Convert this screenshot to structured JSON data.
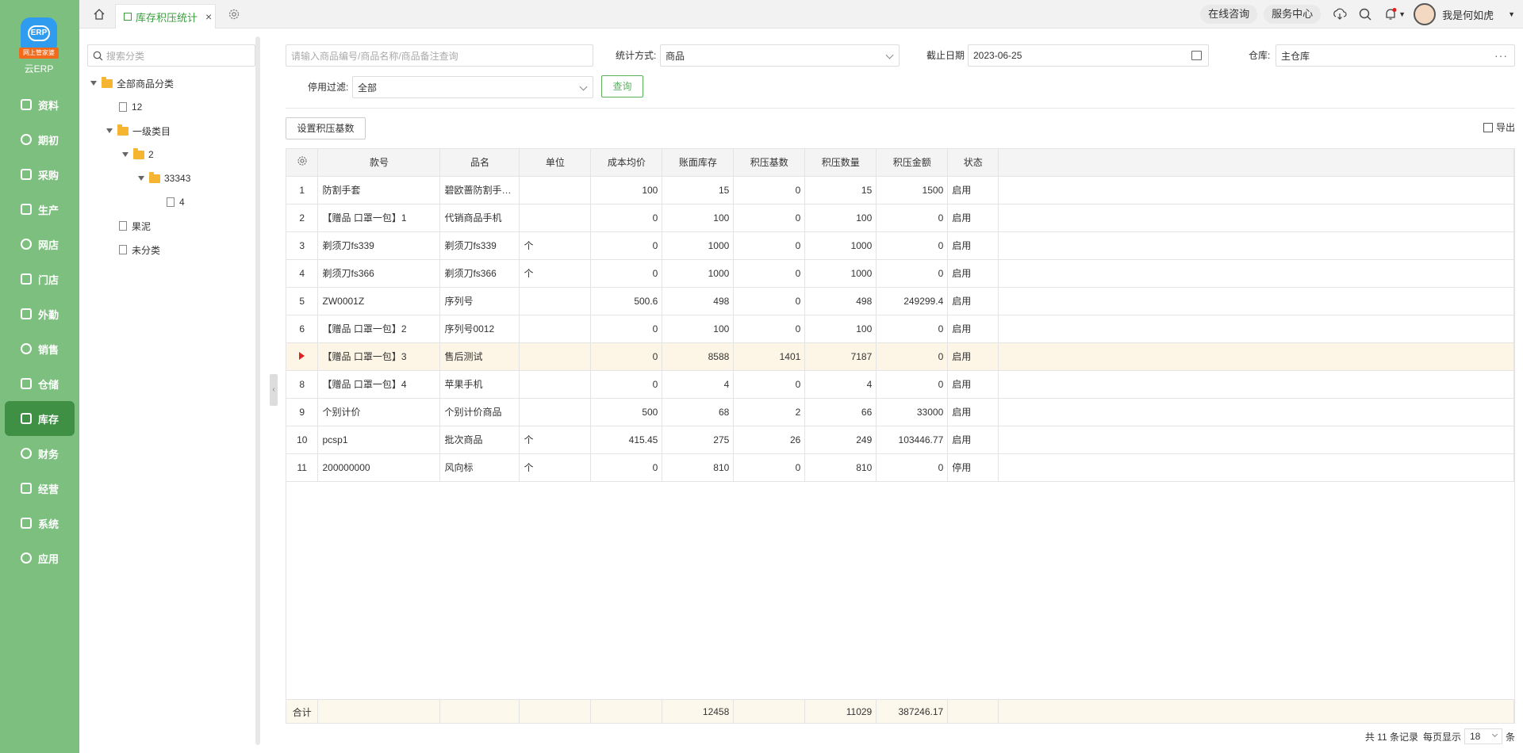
{
  "app": {
    "logo_text": "云ERP",
    "logo_badge": "ERP",
    "logo_ribbon": "网上管家婆"
  },
  "nav": [
    {
      "label": "资料",
      "icon": "data-icon"
    },
    {
      "label": "期初",
      "icon": "opening-icon"
    },
    {
      "label": "采购",
      "icon": "purchase-icon"
    },
    {
      "label": "生产",
      "icon": "production-icon"
    },
    {
      "label": "网店",
      "icon": "online-store-icon"
    },
    {
      "label": "门店",
      "icon": "store-icon"
    },
    {
      "label": "外勤",
      "icon": "field-icon"
    },
    {
      "label": "销售",
      "icon": "sales-icon"
    },
    {
      "label": "仓储",
      "icon": "warehouse-icon"
    },
    {
      "label": "库存",
      "icon": "inventory-icon",
      "active": true
    },
    {
      "label": "财务",
      "icon": "finance-icon"
    },
    {
      "label": "经营",
      "icon": "business-icon"
    },
    {
      "label": "系统",
      "icon": "system-icon"
    },
    {
      "label": "应用",
      "icon": "apps-icon"
    }
  ],
  "topbar": {
    "tab_label": "库存积压统计",
    "online_consult": "在线咨询",
    "service_center": "服务中心",
    "username": "我是何如虎"
  },
  "tree": {
    "search_placeholder": "搜索分类",
    "nodes": {
      "root": "全部商品分类",
      "n12": "12",
      "level1": "一级类目",
      "n2": "2",
      "n33343": "33343",
      "n4": "4",
      "guoni": "果泥",
      "uncat": "未分类"
    }
  },
  "filters": {
    "search_placeholder": "请输入商品编号/商品名称/商品备注查询",
    "stat_mode_label": "统计方式:",
    "stat_mode_value": "商品",
    "deadline_label": "截止日期",
    "deadline_value": "2023-06-25",
    "warehouse_label": "仓库:",
    "warehouse_value": "主仓库",
    "disabled_filter_label": "停用过滤:",
    "disabled_filter_value": "全部",
    "query_button": "查询"
  },
  "toolbar": {
    "set_base_button": "设置积压基数",
    "export_label": "导出"
  },
  "table": {
    "headers": [
      "款号",
      "品名",
      "单位",
      "成本均价",
      "账面库存",
      "积压基数",
      "积压数量",
      "积压金额",
      "状态"
    ],
    "rows": [
      {
        "idx": "1",
        "code": "防割手套",
        "name": "碧欧蔷防割手…",
        "unit": "",
        "cost": "100",
        "stock": "15",
        "base": "0",
        "qty": "15",
        "amount": "1500",
        "status": "启用"
      },
      {
        "idx": "2",
        "code": "【赠品 口罩一包】1",
        "name": "代销商品手机",
        "unit": "",
        "cost": "0",
        "stock": "100",
        "base": "0",
        "qty": "100",
        "amount": "0",
        "status": "启用"
      },
      {
        "idx": "3",
        "code": "剃须刀fs339",
        "name": "剃须刀fs339",
        "unit": "个",
        "cost": "0",
        "stock": "1000",
        "base": "0",
        "qty": "1000",
        "amount": "0",
        "status": "启用"
      },
      {
        "idx": "4",
        "code": "剃须刀fs366",
        "name": "剃须刀fs366",
        "unit": "个",
        "cost": "0",
        "stock": "1000",
        "base": "0",
        "qty": "1000",
        "amount": "0",
        "status": "启用"
      },
      {
        "idx": "5",
        "code": "ZW0001Z",
        "name": "序列号",
        "unit": "",
        "cost": "500.6",
        "stock": "498",
        "base": "0",
        "qty": "498",
        "amount": "249299.4",
        "status": "启用"
      },
      {
        "idx": "6",
        "code": "【赠品 口罩一包】2",
        "name": "序列号0012",
        "unit": "",
        "cost": "0",
        "stock": "100",
        "base": "0",
        "qty": "100",
        "amount": "0",
        "status": "启用"
      },
      {
        "idx": "",
        "selected": true,
        "code": "【赠品 口罩一包】3",
        "name": "售后测试",
        "unit": "",
        "cost": "0",
        "stock": "8588",
        "base": "1401",
        "qty": "7187",
        "amount": "0",
        "status": "启用"
      },
      {
        "idx": "8",
        "code": "【赠品 口罩一包】4",
        "name": "苹果手机",
        "unit": "",
        "cost": "0",
        "stock": "4",
        "base": "0",
        "qty": "4",
        "amount": "0",
        "status": "启用"
      },
      {
        "idx": "9",
        "code": "个别计价",
        "name": "个别计价商品",
        "unit": "",
        "cost": "500",
        "stock": "68",
        "base": "2",
        "qty": "66",
        "amount": "33000",
        "status": "启用"
      },
      {
        "idx": "10",
        "code": "pcsp1",
        "name": "批次商品",
        "unit": "个",
        "cost": "415.45",
        "stock": "275",
        "base": "26",
        "qty": "249",
        "amount": "103446.77",
        "status": "启用"
      },
      {
        "idx": "11",
        "code": "200000000",
        "name": "风向标",
        "unit": "个",
        "cost": "0",
        "stock": "810",
        "base": "0",
        "qty": "810",
        "amount": "0",
        "status": "停用"
      }
    ],
    "summary": {
      "label": "合计",
      "stock": "12458",
      "qty": "11029",
      "amount": "387246.17"
    }
  },
  "pager": {
    "total_text": "共 11 条记录",
    "per_page_label": "每页显示",
    "per_page_value": "18",
    "unit": "条"
  },
  "colors": {
    "sidebar": "#7dbf7f",
    "active_nav": "#3f8f45",
    "accent": "#3a9c3e",
    "selected_row": "#fdf6e6"
  }
}
